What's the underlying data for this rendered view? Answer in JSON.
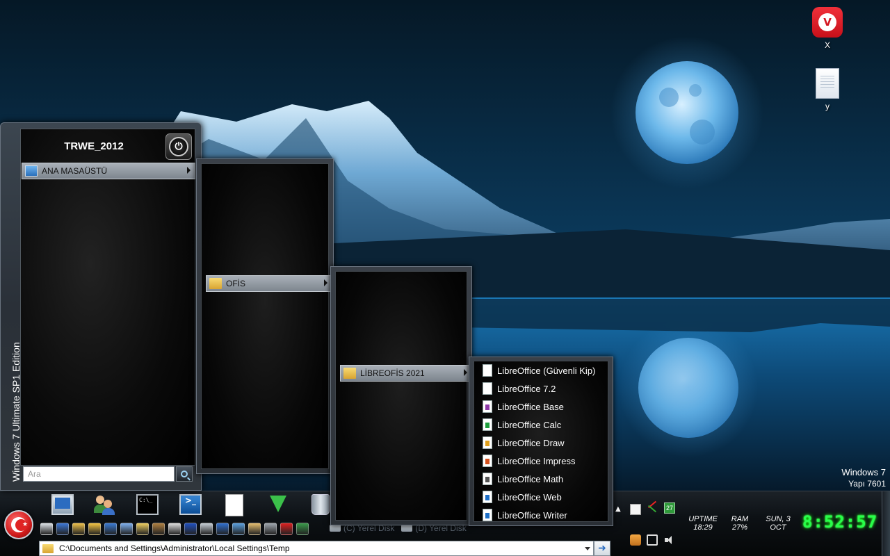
{
  "desktop": {
    "icons": [
      {
        "label": "X",
        "icon": "vivaldi-browser-icon",
        "glyph": "V"
      },
      {
        "label": "y",
        "icon": "text-document-icon"
      }
    ],
    "watermark": {
      "line1": "Windows 7",
      "line2": "Yapı 7601"
    }
  },
  "start_menu": {
    "edition": "Windows 7 Ultimate SP1 Edition",
    "user": "TRWE_2012",
    "top_item": "ANA MASAÜSTÜ",
    "search_placeholder": "Ara"
  },
  "submenus": {
    "ofis": "OFİS",
    "libreofis": "LİBREOFİS 2021"
  },
  "libreoffice_items": [
    {
      "label": "LibreOffice (Güvenli Kip)",
      "icon": "document-icon",
      "color": "#ffffff"
    },
    {
      "label": "LibreOffice 7.2",
      "icon": "document-icon",
      "color": "#ffffff"
    },
    {
      "label": "LibreOffice Base",
      "icon": "base-icon",
      "color": "#8e3aa8"
    },
    {
      "label": "LibreOffice Calc",
      "icon": "calc-icon",
      "color": "#1f9e3c"
    },
    {
      "label": "LibreOffice Draw",
      "icon": "draw-icon",
      "color": "#e0a01c"
    },
    {
      "label": "LibreOffice Impress",
      "icon": "impress-icon",
      "color": "#d4511e"
    },
    {
      "label": "LibreOffice Math",
      "icon": "math-icon",
      "color": "#555555"
    },
    {
      "label": "LibreOffice Web",
      "icon": "web-icon",
      "color": "#1e70c8"
    },
    {
      "label": "LibreOffice Writer",
      "icon": "writer-icon",
      "color": "#1e70c8"
    }
  ],
  "taskbar": {
    "cmd_label": "C:\\_",
    "ps_label": ">_",
    "address": "C:\\Documents and Settings\\Administrator\\Local Settings\\Temp",
    "go_glyph": "➜",
    "drives": [
      "(C) Yerel Disk",
      "(D) Yerel Disk"
    ],
    "quick_launch_colors": [
      "#dfe4ea",
      "#3c78d8",
      "#f0c24a",
      "#f5c542",
      "#3a7bd5",
      "#7fb2f0",
      "#f0d060",
      "#b08040",
      "#e0e0e0",
      "#2050c0",
      "#c8d0d8",
      "#3070d0",
      "#5aa0e0",
      "#e8c070",
      "#a0a8b0",
      "#e02020",
      "#3a9a4a"
    ],
    "calendar_day": "27",
    "uptime": {
      "label": "UPTIME",
      "value": "18:29"
    },
    "ram": {
      "label": "RAM",
      "value": "27%"
    },
    "date": {
      "line1": "SUN, 3",
      "line2": "OCT"
    },
    "clock": "8:52:57"
  }
}
